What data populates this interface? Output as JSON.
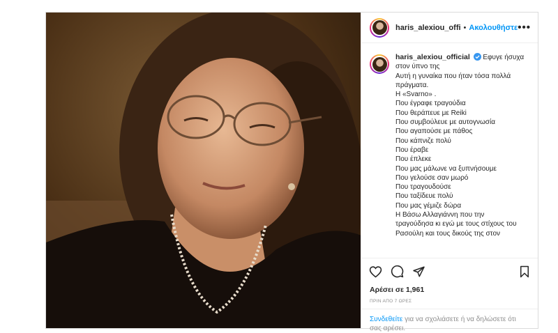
{
  "post": {
    "username_short": "haris_alexiou_offic",
    "follow_label": "Ακολουθήστε",
    "dot": "•",
    "more_label": "•••",
    "caption": {
      "username": "haris_alexiou_official",
      "lines": [
        "Εφυγε ήσυχα",
        "στον ύπνο της",
        "Αυτή η γυναίκα που ήταν τόσα πολλά",
        "πράγματα.",
        "Η «Svarno» .",
        "Που έγραφε τραγούδια",
        "Που θεράπευε με Reiki",
        "Που συμβούλευε με αυτογνωσία",
        "Που αγαπούσε με πάθος",
        "Που κάπνιζε πολύ",
        "Που έραβε",
        "Που έπλεκε",
        "Που μας μάλωνε να ξυπνήσουμε",
        "Που γελούσε σαν μωρό",
        "Που τραγουδούσε",
        "Που ταξίδευε πολύ",
        "Που μας γέμιζε δώρα",
        "Η Βάσω Αλλαγιάννη που την",
        "τραγούδησα κι εγώ με τους στίχους του",
        "Ρασούλη και τους δικούς της στον"
      ]
    },
    "likes": "Αρέσει σε 1,961",
    "time_ago": "ΠΡΙΝ ΑΠΟ 7 ΩΡΕΣ",
    "login_link": "Συνδεθείτε",
    "login_text": " για να σχολιάσετε ή να δηλώσετε ότι σας αρέσει.",
    "colors": {
      "link": "#0095f6",
      "verified": "#3897f0",
      "border": "#dbdbdb"
    },
    "icons": [
      "heart-icon",
      "comment-icon",
      "share-icon",
      "bookmark-icon",
      "verified-badge-icon"
    ]
  }
}
